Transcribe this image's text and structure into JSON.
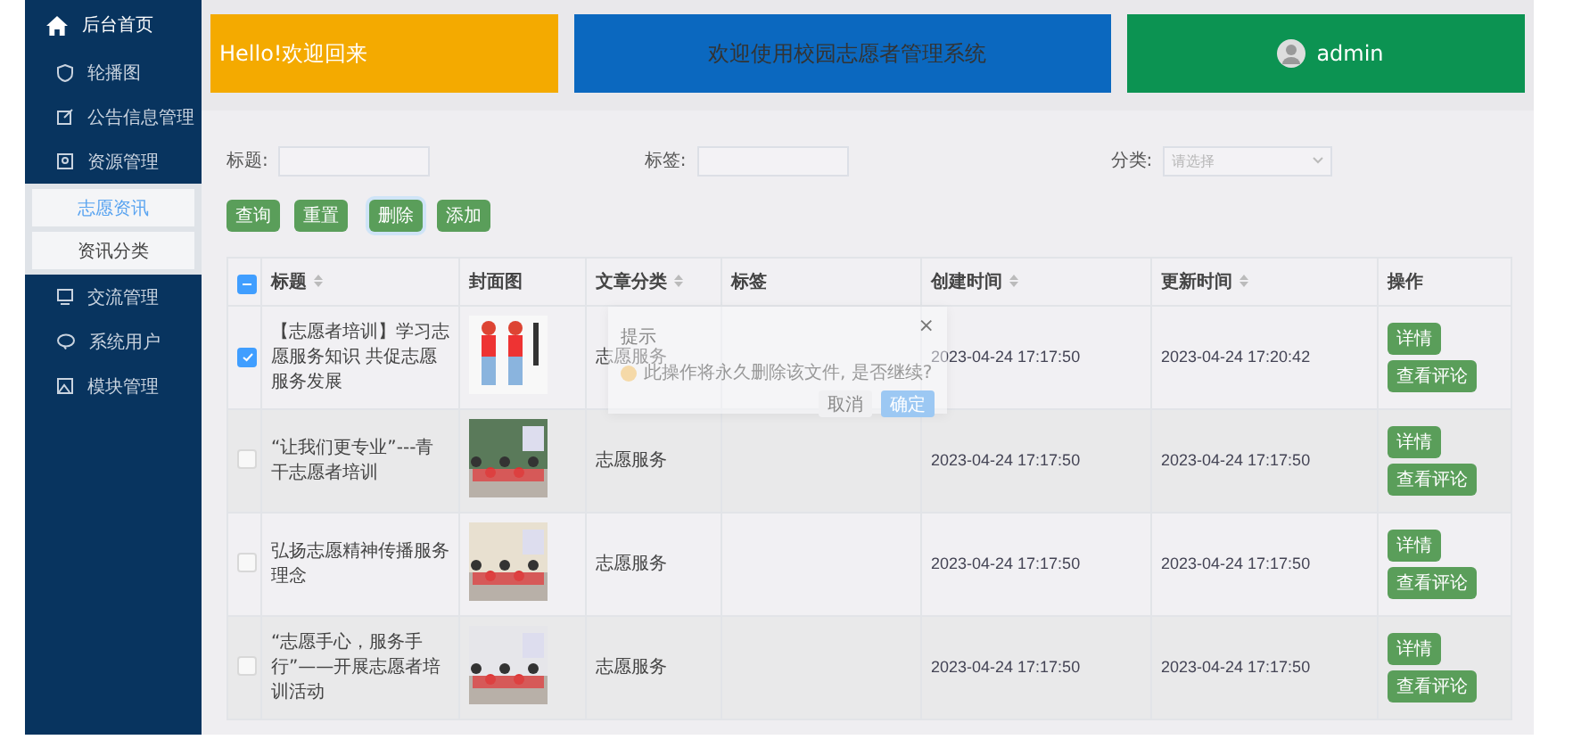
{
  "sidebar": {
    "header": "后台首页",
    "items": [
      {
        "label": "轮播图"
      },
      {
        "label": "公告信息管理"
      },
      {
        "label": "资源管理",
        "expanded": true,
        "children": [
          {
            "label": "志愿资讯",
            "selected": true
          },
          {
            "label": "资讯分类",
            "selected": false
          }
        ]
      },
      {
        "label": "交流管理"
      },
      {
        "label": "系统用户"
      },
      {
        "label": "模块管理"
      }
    ]
  },
  "cards": [
    {
      "kind": "greeting",
      "text": "Hello!欢迎回来"
    },
    {
      "kind": "title",
      "text": "欢迎使用校园志愿者管理系统"
    },
    {
      "kind": "user",
      "text": "admin"
    }
  ],
  "search": {
    "fields": [
      {
        "kind": "input",
        "label": "标题:"
      },
      {
        "kind": "input",
        "label": "标签:"
      },
      {
        "kind": "select",
        "label": "分类:",
        "placeholder": "请选择"
      }
    ],
    "buttons": [
      {
        "label": "查询",
        "focused": false
      },
      {
        "label": "重置",
        "focused": false
      },
      {
        "label": "删除",
        "focused": true
      },
      {
        "label": "添加",
        "focused": false
      }
    ]
  },
  "table": {
    "header_checkbox": {
      "indeterminate": true
    },
    "columns": [
      {
        "label": "标题",
        "sortable": true
      },
      {
        "label": "封面图",
        "sortable": false
      },
      {
        "label": "文章分类",
        "sortable": true
      },
      {
        "label": "标签",
        "sortable": false
      },
      {
        "label": "创建时间",
        "sortable": true
      },
      {
        "label": "更新时间",
        "sortable": true
      },
      {
        "label": "操作",
        "sortable": false
      }
    ],
    "rows": [
      {
        "checked": true,
        "title": "【志愿者培训】学习志愿服务知识 共促志愿服务发展",
        "cover": {
          "kind": "picture"
        },
        "category": "志愿服务",
        "created": "2023-04-24 17:17:50",
        "updated": "2023-04-24 17:20:42",
        "actions": [
          "详情",
          "查看评论"
        ]
      },
      {
        "checked": false,
        "title": "“让我们更专业”---青干志愿者培训",
        "cover": {
          "kind": "picture"
        },
        "category": "志愿服务",
        "created": "2023-04-24 17:17:50",
        "updated": "2023-04-24 17:17:50",
        "actions": [
          "详情",
          "查看评论"
        ]
      },
      {
        "checked": false,
        "title": "弘扬志愿精神传播服务理念",
        "cover": {
          "kind": "picture"
        },
        "category": "志愿服务",
        "created": "2023-04-24 17:17:50",
        "updated": "2023-04-24 17:17:50",
        "actions": [
          "详情",
          "查看评论"
        ]
      },
      {
        "checked": false,
        "title": "“志愿手心，服务手行”——开展志愿者培训活动",
        "cover": {
          "kind": "picture"
        },
        "category": "志愿服务",
        "created": "2023-04-24 17:17:50",
        "updated": "2023-04-24 17:17:50",
        "actions": [
          "详情",
          "查看评论"
        ]
      }
    ]
  },
  "dialog": {
    "title": "提示",
    "close": "×",
    "message": "此操作将永久删除该文件, 是否继续?",
    "buttons": [
      {
        "label": "取消",
        "primary": false
      },
      {
        "label": "确定",
        "primary": true
      }
    ]
  }
}
